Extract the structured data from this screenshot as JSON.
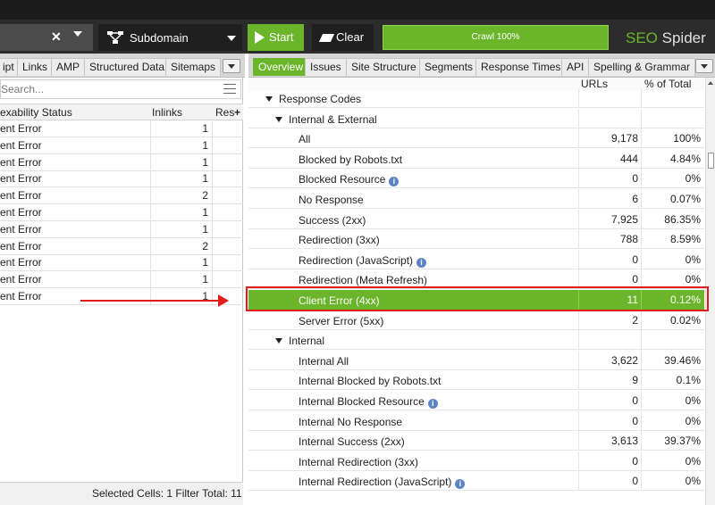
{
  "toolbar": {
    "url_clear_icon": "x-icon",
    "mode_label": "Subdomain",
    "start_label": "Start",
    "clear_label": "Clear",
    "progress_label": "Crawl 100%",
    "progress_value": 1.0,
    "brand_seo": "SEO",
    "brand_spider": "Spider",
    "accent_color": "#6bb52b"
  },
  "left_tabs": [
    "ipt",
    "Links",
    "AMP",
    "Structured Data",
    "Sitemaps"
  ],
  "right_tabs": [
    "Overview",
    "Issues",
    "Site Structure",
    "Segments",
    "Response Times",
    "API",
    "Spelling & Grammar"
  ],
  "left_panel": {
    "search_placeholder": "Search...",
    "columns": [
      "exability Status",
      "Inlinks",
      "Res"
    ],
    "rows": [
      {
        "status": "ent Error",
        "inlinks": "1"
      },
      {
        "status": "ent Error",
        "inlinks": "1"
      },
      {
        "status": "ent Error",
        "inlinks": "1"
      },
      {
        "status": "ent Error",
        "inlinks": "1"
      },
      {
        "status": "ent Error",
        "inlinks": "2"
      },
      {
        "status": "ent Error",
        "inlinks": "1"
      },
      {
        "status": "ent Error",
        "inlinks": "1"
      },
      {
        "status": "ent Error",
        "inlinks": "2"
      },
      {
        "status": "ent Error",
        "inlinks": "1"
      },
      {
        "status": "ent Error",
        "inlinks": "1"
      },
      {
        "status": "ent Error",
        "inlinks": "1"
      }
    ],
    "status_text": "Selected Cells:  1  Filter Total:  11"
  },
  "right_panel": {
    "columns": [
      "URLs",
      "% of Total"
    ],
    "rows": [
      {
        "label": "Response Codes",
        "urls": "",
        "pct": "",
        "level": 0,
        "caret": true
      },
      {
        "label": "Internal & External",
        "urls": "",
        "pct": "",
        "level": 1,
        "caret": true
      },
      {
        "label": "All",
        "urls": "9,178",
        "pct": "100%",
        "level": 2
      },
      {
        "label": "Blocked by Robots.txt",
        "urls": "444",
        "pct": "4.84%",
        "level": 2
      },
      {
        "label": "Blocked Resource",
        "urls": "0",
        "pct": "0%",
        "level": 2,
        "info": true
      },
      {
        "label": "No Response",
        "urls": "6",
        "pct": "0.07%",
        "level": 2
      },
      {
        "label": "Success (2xx)",
        "urls": "7,925",
        "pct": "86.35%",
        "level": 2
      },
      {
        "label": "Redirection (3xx)",
        "urls": "788",
        "pct": "8.59%",
        "level": 2
      },
      {
        "label": "Redirection (JavaScript)",
        "urls": "0",
        "pct": "0%",
        "level": 2,
        "info": true
      },
      {
        "label": "Redirection (Meta Refresh)",
        "urls": "0",
        "pct": "0%",
        "level": 2
      },
      {
        "label": "Client Error (4xx)",
        "urls": "11",
        "pct": "0.12%",
        "level": 2,
        "highlight": true
      },
      {
        "label": "Server Error (5xx)",
        "urls": "2",
        "pct": "0.02%",
        "level": 2
      },
      {
        "label": "Internal",
        "urls": "",
        "pct": "",
        "level": 1,
        "caret": true
      },
      {
        "label": "Internal All",
        "urls": "3,622",
        "pct": "39.46%",
        "level": 2
      },
      {
        "label": "Internal Blocked by Robots.txt",
        "urls": "9",
        "pct": "0.1%",
        "level": 2
      },
      {
        "label": "Internal Blocked Resource",
        "urls": "0",
        "pct": "0%",
        "level": 2,
        "info": true
      },
      {
        "label": "Internal No Response",
        "urls": "0",
        "pct": "0%",
        "level": 2
      },
      {
        "label": "Internal Success (2xx)",
        "urls": "3,613",
        "pct": "39.37%",
        "level": 2
      },
      {
        "label": "Internal Redirection (3xx)",
        "urls": "0",
        "pct": "0%",
        "level": 2
      },
      {
        "label": "Internal Redirection (JavaScript)",
        "urls": "0",
        "pct": "0%",
        "level": 2,
        "info": true
      }
    ]
  },
  "annotation_color": "#e31b1b"
}
